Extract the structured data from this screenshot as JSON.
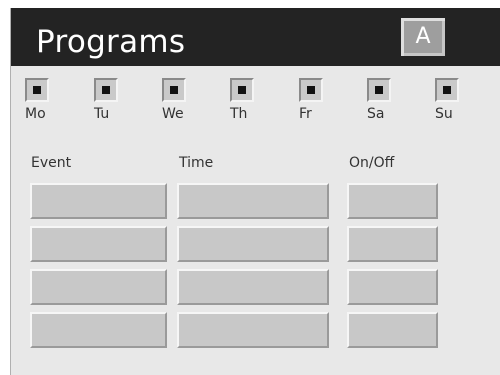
{
  "window": {
    "title": "Programs",
    "mode_button": "A"
  },
  "days": [
    {
      "label": "Mo",
      "checked": true
    },
    {
      "label": "Tu",
      "checked": true
    },
    {
      "label": "We",
      "checked": true
    },
    {
      "label": "Th",
      "checked": true
    },
    {
      "label": "Fr",
      "checked": true
    },
    {
      "label": "Sa",
      "checked": true
    },
    {
      "label": "Su",
      "checked": true
    }
  ],
  "table": {
    "headers": {
      "event": "Event",
      "time": "Time",
      "onoff": "On/Off"
    },
    "rows": [
      {
        "event": "",
        "time": "",
        "onoff": ""
      },
      {
        "event": "",
        "time": "",
        "onoff": ""
      },
      {
        "event": "",
        "time": "",
        "onoff": ""
      },
      {
        "event": "",
        "time": "",
        "onoff": ""
      }
    ]
  },
  "colors": {
    "titlebar": "#232323",
    "panel": "#e8e8e8",
    "field": "#c8c8c8"
  }
}
